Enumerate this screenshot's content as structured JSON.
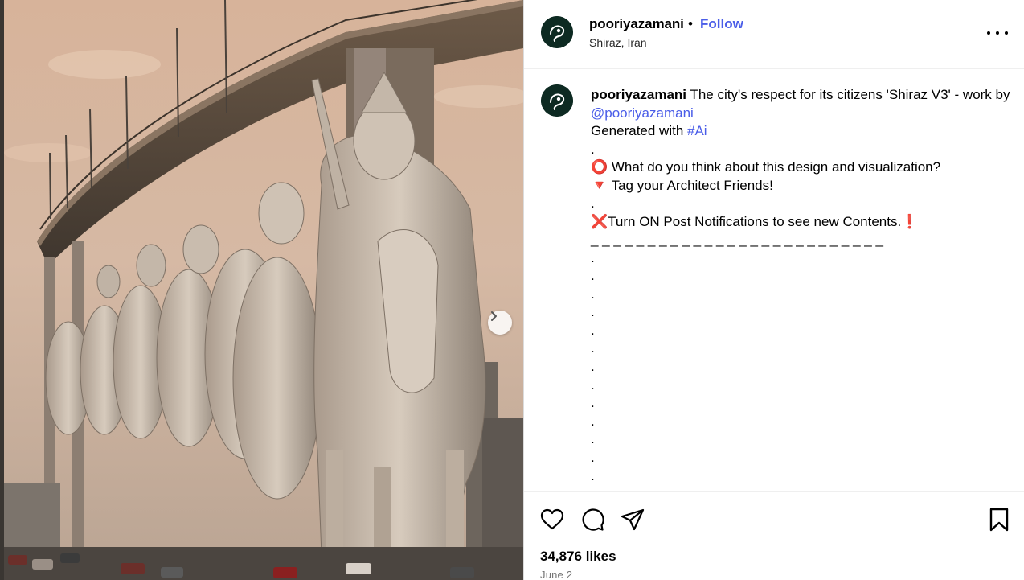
{
  "post": {
    "username": "pooriyazamani",
    "separator": "•",
    "follow_label": "Follow",
    "location": "Shiraz, Iran",
    "more_icon": "more-horizontal-icon"
  },
  "caption": {
    "username": "pooriyazamani",
    "text_1": " The city's respect for its citizens 'Shiraz V3' - work by ",
    "mention": "@pooriyazamani",
    "line_2_prefix": "Generated with ",
    "hashtag": "#Ai",
    "dot_1": ".",
    "question_line": "⭕ What do you think about this design and visualization?",
    "tag_line": "🔻 Tag your Architect Friends!",
    "dot_2": ".",
    "notify_line": "❌Turn ON Post Notifications to see new Contents.❗",
    "underscore_line": "_ _ _ _ _ _ _ _ _ _ _ _ _ _ _ _ _ _ _ _ _ _ _ _ _ _",
    "trailing_dots": [
      ".",
      ".",
      ".",
      ".",
      ".",
      ".",
      ".",
      ".",
      ".",
      ".",
      ".",
      ".",
      "."
    ]
  },
  "actions": {
    "like_icon": "heart-icon",
    "comment_icon": "comment-icon",
    "share_icon": "share-icon",
    "save_icon": "bookmark-icon"
  },
  "likes_text": "34,876 likes",
  "date_text": "June 2",
  "colors": {
    "link": "#4a5de8",
    "avatar_bg": "#0d2a22",
    "border": "#dbdbdb",
    "muted": "#737373"
  }
}
